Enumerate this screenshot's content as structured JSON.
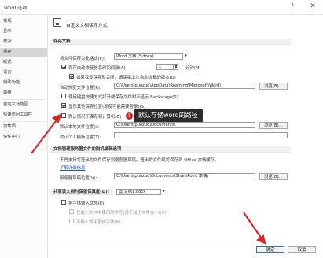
{
  "window": {
    "title": "Word 选项",
    "help": "?",
    "close": "✕"
  },
  "sidebar": {
    "items": [
      {
        "label": "常规"
      },
      {
        "label": "显示"
      },
      {
        "label": "校对"
      },
      {
        "label": "保存"
      },
      {
        "label": "版式"
      },
      {
        "label": "语言"
      },
      {
        "label": "辅助功能"
      },
      {
        "label": "高级"
      },
      {
        "label": "自定义功能区"
      },
      {
        "label": "快速访问工具栏"
      },
      {
        "label": "加载项"
      },
      {
        "label": "信任中心"
      }
    ],
    "selected_index": 3
  },
  "header": {
    "text": "自定义文档保存方式。"
  },
  "save_docs": {
    "section_title": "保存文档",
    "format_label": "将文件保存为此格式(F):",
    "format_value": "Word 文档 (*.docx)",
    "autorecover_label": "保存自动恢复信息时间间隔(A)",
    "autorecover_minutes": "1",
    "minutes_label": "分钟(M)",
    "keep_last_label": "如果我没保存就关闭，请保留上次自动恢复的版本(U)",
    "autorecover_loc_label": "自动恢复文件位置(R):",
    "autorecover_path": "C:\\Users\\puozuo\\AppData\\Roaming\\Microsoft\\Word\\",
    "browse1": "浏览(B)...",
    "no_backstage_label": "使用键盘快捷方式打开或保存文件时不显示 Backstage(S)",
    "show_other_label": "显示其他保存位置(即使可能需要登录)(S)",
    "default_local_label": "默认情况下保存到计算机(C)",
    "default_local_loc_label": "默认本地文件位置(I):",
    "default_local_path": "C:\\Users\\puozuo\\Documents\\",
    "browse2": "浏览(B)...",
    "personal_template_label": "默认个人模板位置(T):",
    "personal_template_value": ""
  },
  "tooltip": {
    "badge": "1",
    "text": "默认存储word的路径"
  },
  "offline": {
    "section_title": "文档管理服务器文件的脱机编辑选项",
    "desc": "不再支持将签出的文件保存到服务器草稿。签出的文件现将保存到 Office 文档缓存。",
    "link": "了解详细信息",
    "drafts_label": "服务器草稿位置(V):",
    "drafts_path": "C:\\Users\\puozuo\\Documents\\SharePoint 草稿\\",
    "browse3": "浏览(B)..."
  },
  "fidelity": {
    "section_title": "共享该文档时保留保真度(D):",
    "doc_value": "文档1.docx",
    "embed_fonts_label": "将字体嵌入文件(E)",
    "embed_only_used_label": "仅嵌入文档中使用的字符(适于减小文件大小)(C)",
    "no_common_label": "不嵌入常用系统字体(N)"
  },
  "footer": {
    "ok": "确定",
    "cancel": "取消"
  }
}
